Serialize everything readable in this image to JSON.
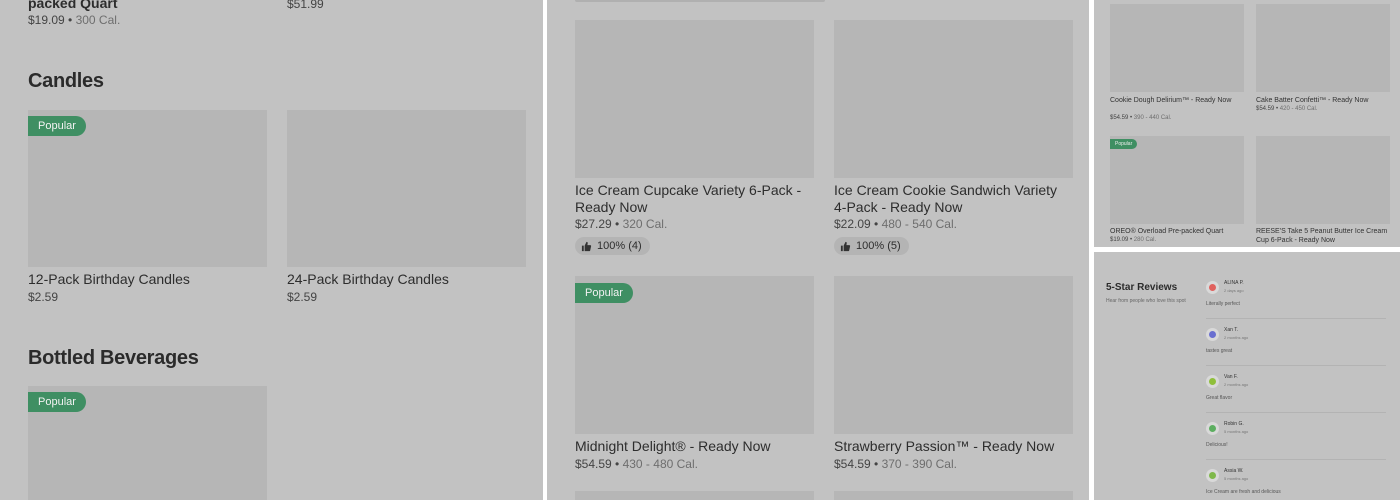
{
  "left": {
    "top_items": [
      {
        "name": "packed Quart",
        "price": "$19.09",
        "cal": "300 Cal."
      },
      {
        "price": "$51.99"
      }
    ],
    "candles_heading": "Candles",
    "candles": [
      {
        "name": "12-Pack Birthday Candles",
        "price": "$2.59",
        "badge": "Popular"
      },
      {
        "name": "24-Pack Birthday Candles",
        "price": "$2.59"
      }
    ],
    "beverages_heading": "Bottled Beverages",
    "beverages": [
      {
        "badge": "Popular"
      }
    ]
  },
  "middle": {
    "items": [
      {
        "name": "Ice Cream Cupcake Variety 6-Pack - Ready Now",
        "price": "$27.29",
        "cal": "320 Cal.",
        "rating": "100% (4)"
      },
      {
        "name": "Ice Cream Cookie Sandwich Variety 4-Pack - Ready Now",
        "price": "$22.09",
        "cal": "480 - 540 Cal.",
        "rating": "100% (5)"
      },
      {
        "name": "Midnight Delight® - Ready Now",
        "price": "$54.59",
        "cal": "430 - 480 Cal.",
        "badge": "Popular"
      },
      {
        "name": "Strawberry Passion™  - Ready Now",
        "price": "$54.59",
        "cal": "370 - 390 Cal."
      }
    ]
  },
  "top_right": {
    "items": [
      {
        "name": "Cookie Dough Delirium™ - Ready Now",
        "price": "$54.59",
        "cal": "390 - 440 Cal."
      },
      {
        "name": "Cake Batter Confetti™ - Ready Now",
        "price": "$54.59",
        "cal": "420 - 450 Cal."
      },
      {
        "name": "OREO® Overload Pre-packed Quart",
        "price": "$19.09",
        "cal": "280 Cal.",
        "badge": "Popular"
      },
      {
        "name": "REESE'S Take 5 Peanut Butter Ice Cream Cup  6-Pack - Ready Now"
      }
    ]
  },
  "reviews": {
    "title": "5-Star Reviews",
    "subtitle": "Hear from people who love this spot",
    "items": [
      {
        "name": "ALINA P.",
        "date": "2 days ago",
        "text": "Literally perfect",
        "color": "#e0615e"
      },
      {
        "name": "Xan T.",
        "date": "2 months ago",
        "text": "tastes great",
        "color": "#6a6fd0"
      },
      {
        "name": "Van F.",
        "date": "2 months ago",
        "text": "Great flavor",
        "color": "#8fbf3a"
      },
      {
        "name": "Robin G.",
        "date": "5 months ago",
        "text": "Delicious!",
        "color": "#5cae60"
      },
      {
        "name": "Assia W.",
        "date": "5 months ago",
        "text": "Ice Cream are fresh and delicious",
        "color": "#7fb84a"
      }
    ]
  }
}
